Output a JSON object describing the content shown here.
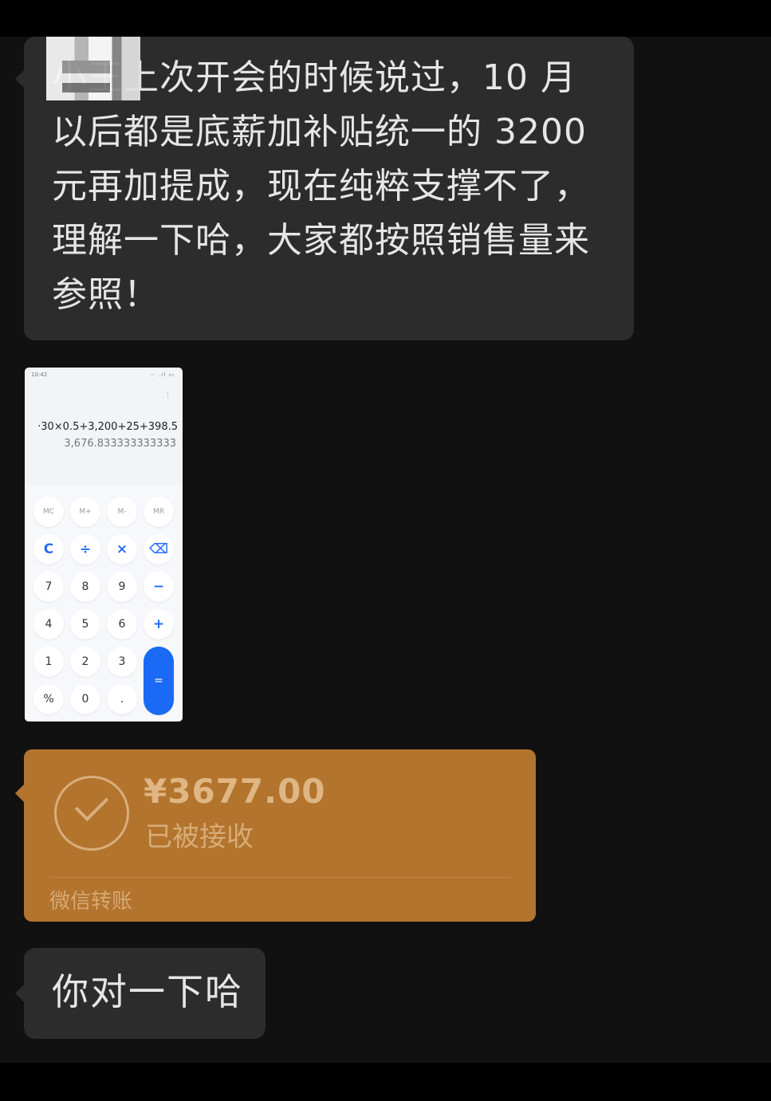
{
  "messages": [
    {
      "type": "text",
      "text": "小王上次开会的时候说过，10 月以后都是底薪加补贴统一的 3200 元再加提成，现在纯粹支撑不了，理解一下哈，大家都按照销售量来参照！"
    },
    {
      "type": "image",
      "calculator": {
        "status_time": "10:42",
        "status_right": "⋯ .ıl ▭",
        "more_icon": "⋮",
        "expression": "·30×0.5+3,200+25+398.5",
        "result": "3,676.833333333333",
        "memory_keys": [
          "MC",
          "M+",
          "M-",
          "MR"
        ],
        "keys": {
          "clear": "C",
          "divide": "÷",
          "multiply": "×",
          "backspace": "⌫",
          "seven": "7",
          "eight": "8",
          "nine": "9",
          "minus": "−",
          "four": "4",
          "five": "5",
          "six": "6",
          "plus": "+",
          "one": "1",
          "two": "2",
          "three": "3",
          "equals": "=",
          "percent": "%",
          "zero": "0",
          "dot": "."
        }
      }
    },
    {
      "type": "transfer",
      "amount": "¥3677.00",
      "status": "已被接收",
      "label": "微信转账"
    },
    {
      "type": "text",
      "text": "你对一下哈"
    }
  ],
  "colors": {
    "background": "#111111",
    "bubble": "#2c2c2c",
    "transfer": "#b3742e",
    "calc_equals": "#1a6af5"
  }
}
